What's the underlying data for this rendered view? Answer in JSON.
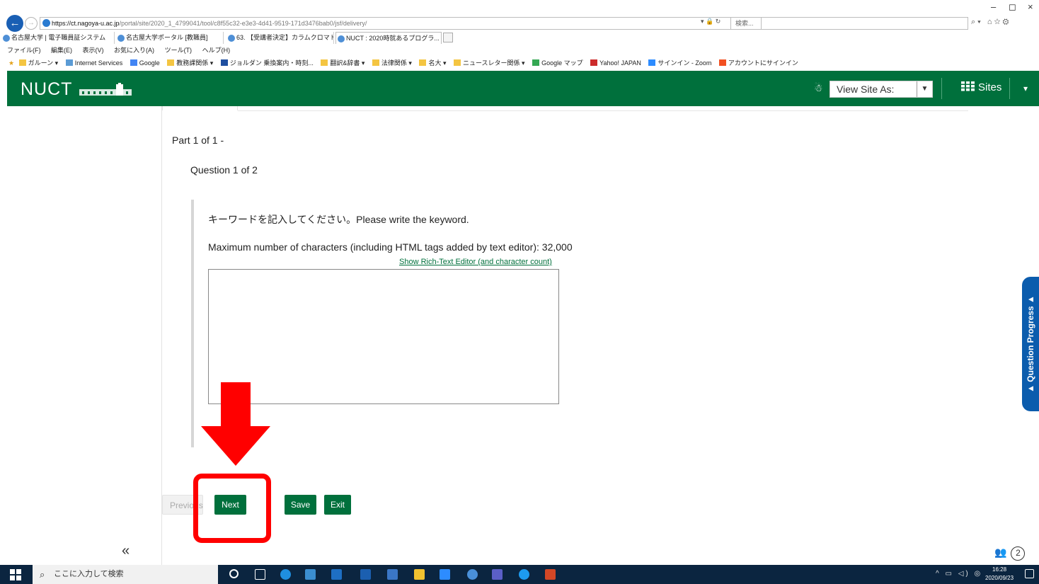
{
  "browser": {
    "url_host": "https://ct.nagoya-u.ac.jp",
    "url_path": "/portal/site/2020_1_4799041/tool/c8f55c32-e3e3-4d41-9519-171d3476bab0/jsf/delivery/",
    "search_placeholder": "検索...",
    "tabs": [
      {
        "label": "名古屋大学 | 電子職員証システム"
      },
      {
        "label": "名古屋大学ポータル [教職員]"
      },
      {
        "label": "63. 【受講者決定】カラムクロマト..."
      },
      {
        "label": "NUCT : 2020時就あるプログラ..."
      }
    ],
    "menu": [
      "ファイル(F)",
      "編集(E)",
      "表示(V)",
      "お気に入り(A)",
      "ツール(T)",
      "ヘルプ(H)"
    ],
    "favorites": [
      "ガルーン ▾",
      "Internet Services",
      "Google",
      "教務課関係 ▾",
      "ジョルダン 乗換案内・時刻...",
      "翻訳&辞書 ▾",
      "法律関係 ▾",
      "名大 ▾",
      "ニュースレター関係 ▾",
      "Google マップ",
      "Yahoo! JAPAN",
      "サインイン - Zoom",
      "アカウントにサインイン"
    ]
  },
  "header": {
    "logo": "NUCT",
    "view_site_as": "View Site As:",
    "sites": "Sites"
  },
  "assessment": {
    "part": "Part 1 of 1 -",
    "question_counter": "Question 1 of 2",
    "question_text": "キーワードを記入してください。Please write the keyword.",
    "max_chars": "Maximum number of characters (including HTML tags added by text editor): 32,000",
    "rte_link": "Show Rich-Text Editor (and character count)",
    "answer": ""
  },
  "buttons": {
    "previous": "Previous",
    "next": "Next",
    "save": "Save",
    "exit": "Exit"
  },
  "question_progress": "▲ Question Progress ▲",
  "collapse": "«",
  "participants_count": "2",
  "taskbar": {
    "search_placeholder": "ここに入力して検索",
    "time": "16:28",
    "date": "2020/09/23"
  },
  "colors": {
    "nuct_green": "#00703c",
    "progress_blue": "#0b5cad",
    "annotation_red": "#ff0000"
  }
}
